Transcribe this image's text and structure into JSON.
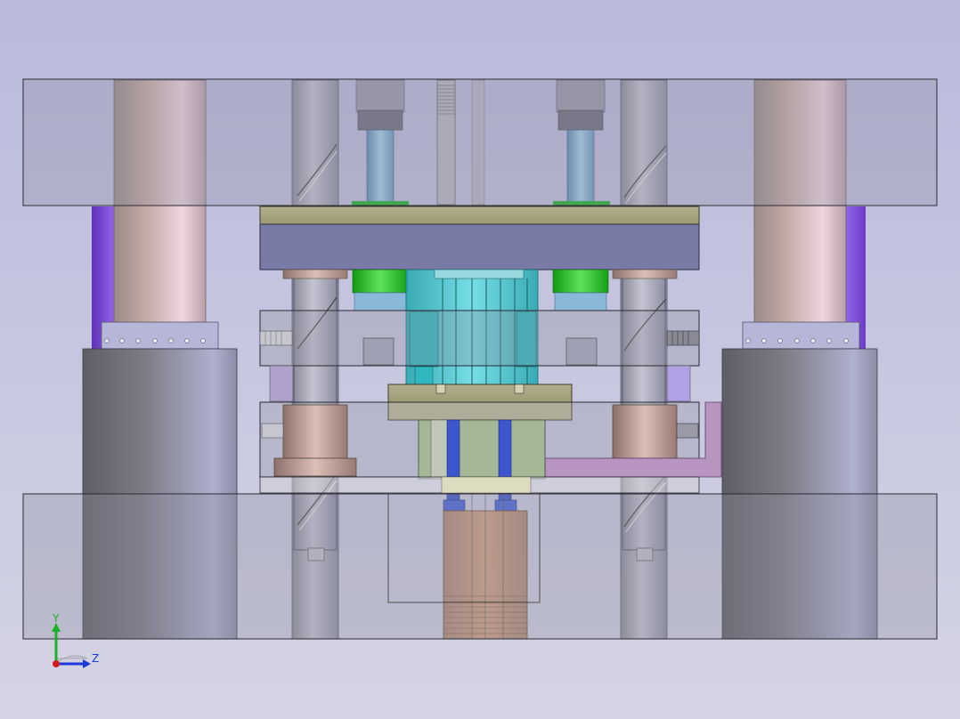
{
  "viewport": {
    "background_top": "#b9b9dc",
    "background_bottom": "#d4d4e4"
  },
  "triad": {
    "y_label": "Y",
    "z_label": "Z",
    "y_color": "#1fb02a",
    "z_color": "#1a39d6",
    "x_color": "#d01c1c"
  },
  "colors": {
    "plate_glass": "#8f8fa0",
    "plate_edge": "#2a2a33",
    "pillar_tan": "#c8a8a4",
    "pillar_gray": "#7c7c8c",
    "guide_post": "#a6a6b6",
    "spring_blue": "#7eb4d8",
    "green_ring": "#22b322",
    "olive_plate": "#a6a47e",
    "slate_plate": "#7a7aa6",
    "cyan_punch": "#38c0c6",
    "violet_side": "#8f5ee0",
    "bronze_bush": "#b89890",
    "orange_die": "#c8885a",
    "pink_block": "#b894c0",
    "blue_pin": "#3c56cc"
  }
}
